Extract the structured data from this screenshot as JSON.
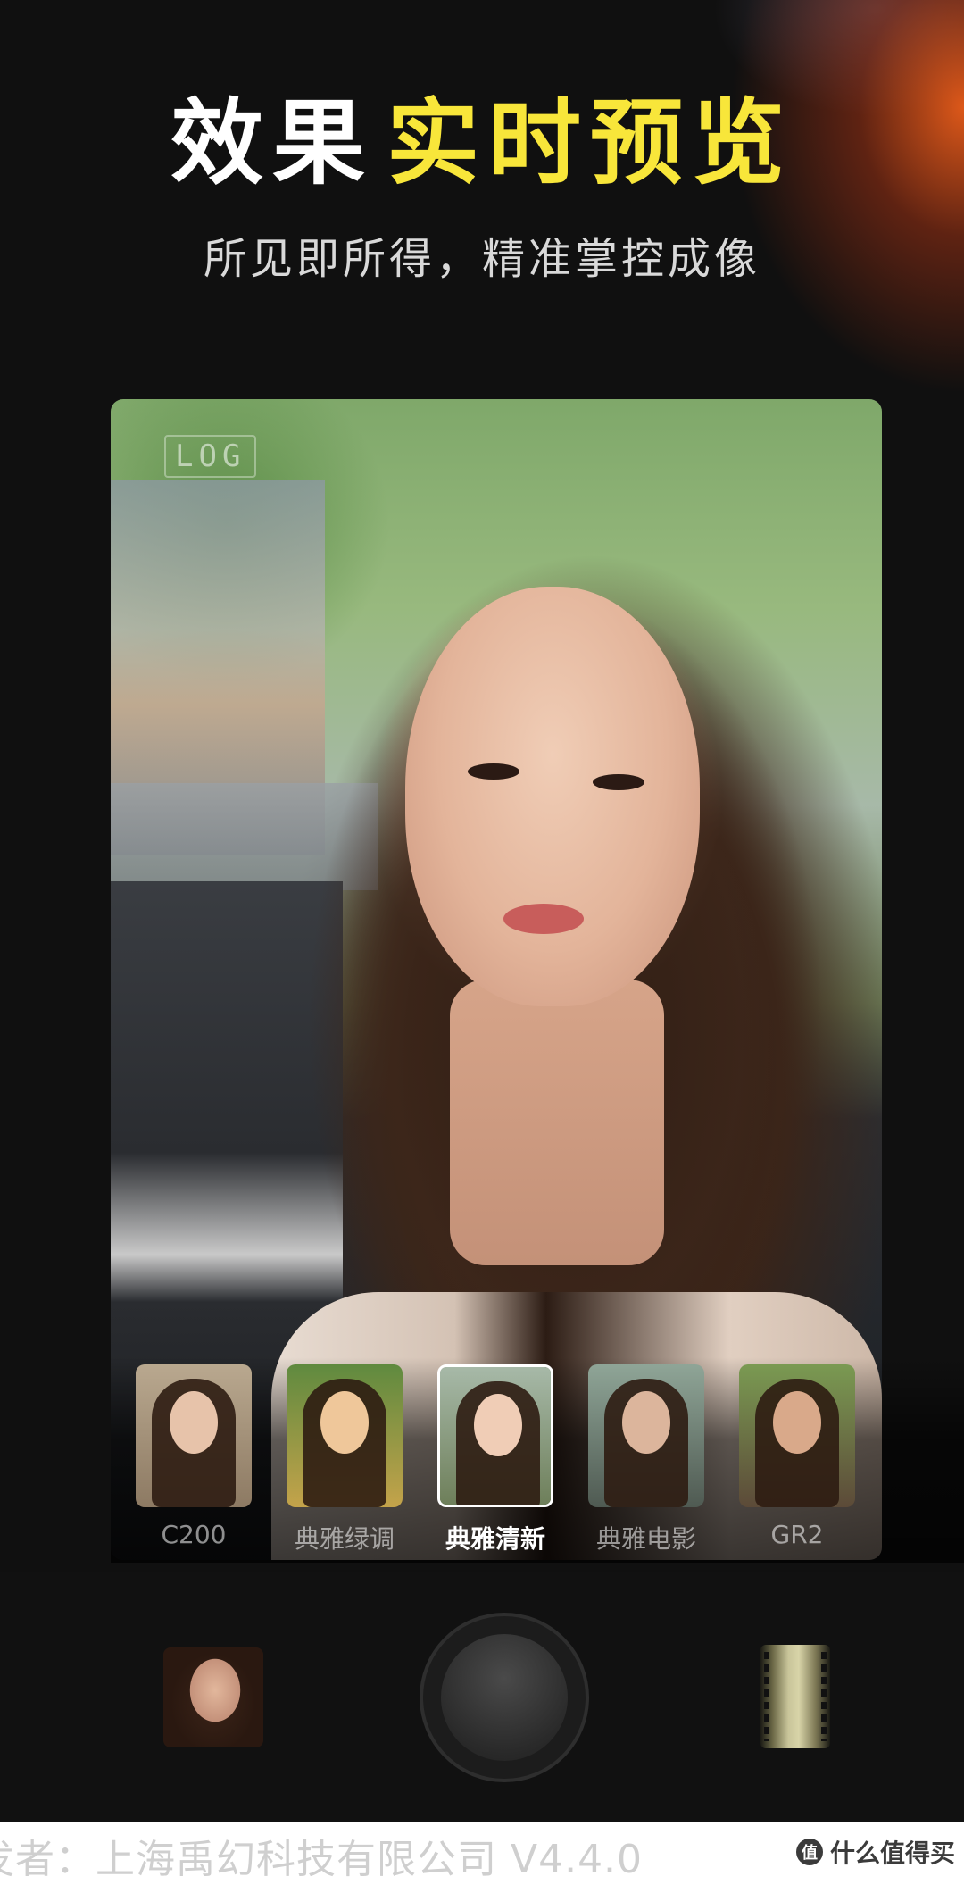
{
  "header": {
    "title_white": "效果",
    "title_yellow": "实时预览",
    "subtitle": "所见即所得，精准掌控成像"
  },
  "viewfinder": {
    "badge": "LOG"
  },
  "filters": [
    {
      "label": "C200",
      "selected": false
    },
    {
      "label": "典雅绿调",
      "selected": false
    },
    {
      "label": "典雅清新",
      "selected": true
    },
    {
      "label": "典雅电影",
      "selected": false
    },
    {
      "label": "GR2",
      "selected": false
    }
  ],
  "controls": {
    "gallery_icon": "gallery-thumbnail",
    "shutter_icon": "shutter-button",
    "film_icon": "film-roll-icon"
  },
  "footer": {
    "text": "发者：上海禹幻科技有限公司  V4.4.0",
    "watermark_symbol": "值",
    "watermark_text": "什么值得买"
  },
  "colors": {
    "accent_yellow": "#f8e63a",
    "background": "#101010",
    "glow_orange": "#e85c1a"
  }
}
